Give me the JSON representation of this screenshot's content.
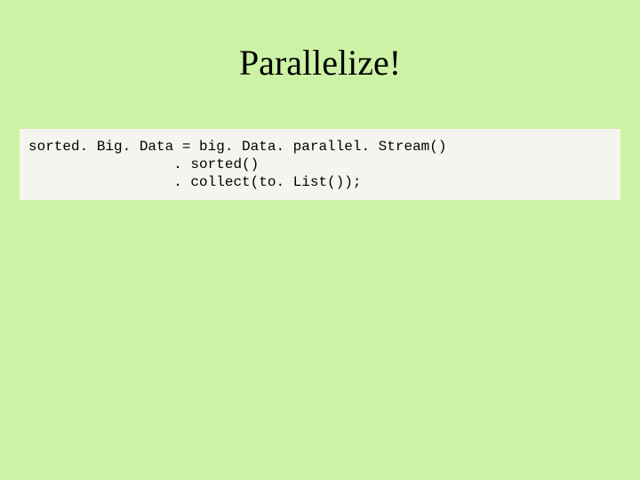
{
  "slide": {
    "title": "Parallelize!",
    "code": "sorted. Big. Data = big. Data. parallel. Stream()\n                 . sorted()\n                 . collect(to. List());"
  }
}
